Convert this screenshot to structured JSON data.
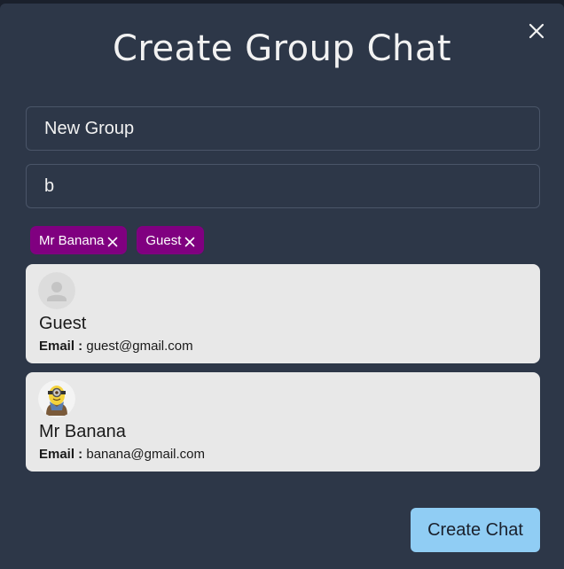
{
  "modal": {
    "title": "Create Group Chat"
  },
  "form": {
    "group_name_value": "New Group",
    "search_value": "b"
  },
  "selected_users": [
    {
      "label": "Mr Banana"
    },
    {
      "label": "Guest"
    }
  ],
  "search_results": [
    {
      "name": "Guest",
      "email_label": "Email :",
      "email": "guest@gmail.com",
      "avatar": "default-user-icon"
    },
    {
      "name": "Mr Banana",
      "email_label": "Email :",
      "email": "banana@gmail.com",
      "avatar": "minion-avatar"
    }
  ],
  "footer": {
    "create_label": "Create Chat"
  },
  "colors": {
    "modal_bg": "#2d3748",
    "chip_bg": "#800080",
    "card_bg": "#e8e8e8",
    "button_bg": "#90cdf4"
  }
}
